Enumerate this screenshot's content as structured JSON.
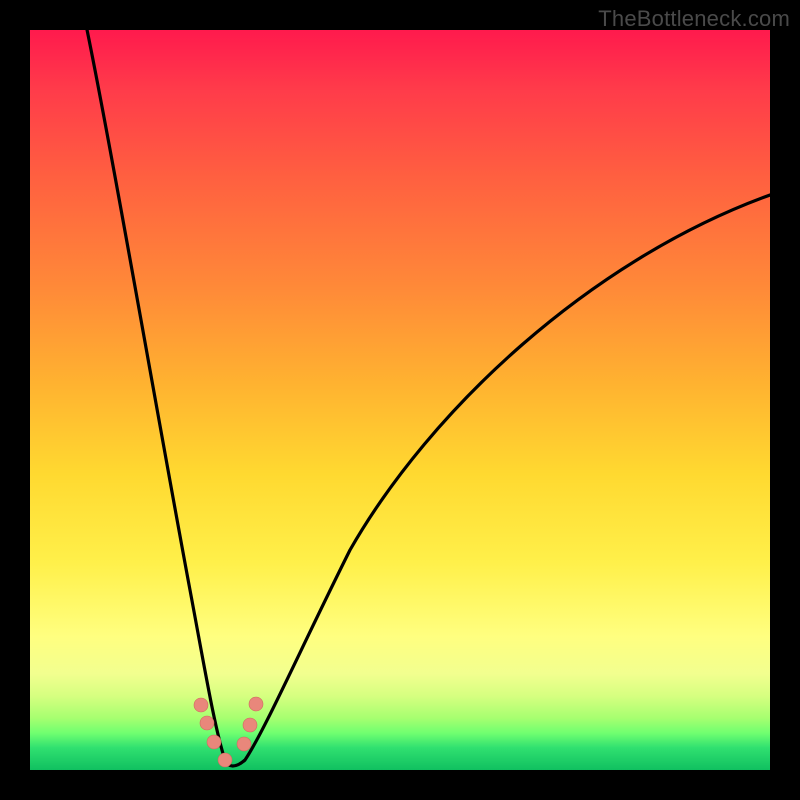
{
  "watermark": "TheBottleneck.com",
  "chart_data": {
    "type": "line",
    "title": "",
    "xlabel": "",
    "ylabel": "",
    "xlim": [
      0,
      100
    ],
    "ylim": [
      0,
      100
    ],
    "grid": false,
    "note": "Bottleneck curve: single V-shaped black line over a red→yellow→green vertical gradient. Curve minimum (≈0% bottleneck) around x≈26. Red dot markers cluster near the trough on both branches.",
    "series": [
      {
        "name": "left-branch",
        "x": [
          5,
          7,
          9,
          11,
          13,
          15,
          17,
          19,
          21,
          23,
          24,
          25,
          26
        ],
        "values": [
          100,
          90,
          80,
          70,
          60,
          50,
          40,
          30,
          20,
          10,
          5,
          2,
          0
        ]
      },
      {
        "name": "right-branch",
        "x": [
          26,
          27,
          28,
          30,
          33,
          37,
          42,
          48,
          55,
          63,
          72,
          82,
          93,
          100
        ],
        "values": [
          0,
          2,
          5,
          10,
          17,
          25,
          33,
          41,
          49,
          56,
          63,
          69,
          74,
          77
        ]
      }
    ],
    "markers": [
      {
        "x": 22.5,
        "y": 8
      },
      {
        "x": 23.3,
        "y": 5
      },
      {
        "x": 24.2,
        "y": 3
      },
      {
        "x": 26.0,
        "y": 1.5
      },
      {
        "x": 28.5,
        "y": 3.5
      },
      {
        "x": 29.5,
        "y": 6
      },
      {
        "x": 30.0,
        "y": 9
      }
    ],
    "marker_color": "#e9877b",
    "gradient_colors": {
      "top": "#ff1a4d",
      "mid": "#ffe040",
      "bottom": "#10c060"
    }
  }
}
